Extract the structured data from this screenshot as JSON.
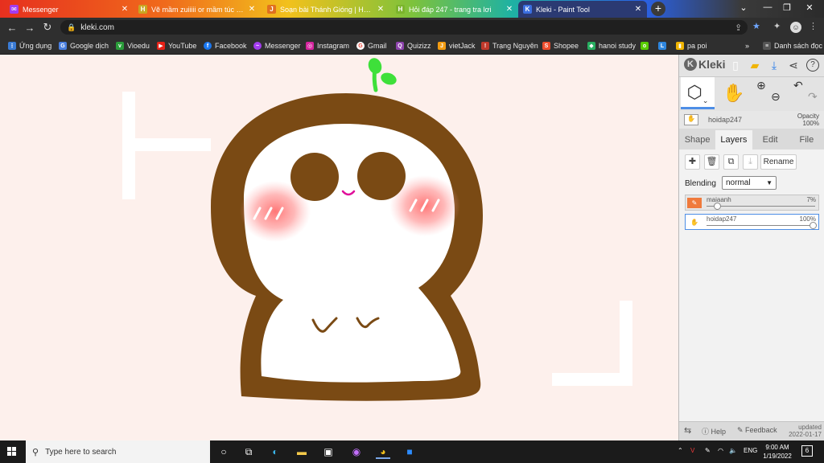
{
  "browser": {
    "tabs": [
      {
        "title": "Messenger",
        "icon": "messenger-icon",
        "color": "#a33cf0"
      },
      {
        "title": "Vẽ mầm zuiiiii or mầm túc mừng",
        "icon": "hoidap-icon",
        "color": "#c9a622"
      },
      {
        "title": "Soạn bài Thánh Gióng | Hay nhất",
        "icon": "vietjack-icon",
        "color": "#e0701f"
      },
      {
        "title": "Hỏi đáp 247 - trang tra lơi",
        "icon": "hoidap-icon",
        "color": "#7bb42c"
      },
      {
        "title": "Kleki - Paint Tool",
        "icon": "kleki-icon",
        "color": "#3b6fe0"
      }
    ],
    "new_tab": "+",
    "window_controls": {
      "minimize": "—",
      "restore": "❐",
      "close": "✕"
    },
    "url": "kleki.com",
    "bookmarks": [
      {
        "label": "Ứng dụng",
        "color": "#3a7bd5"
      },
      {
        "label": "Google dịch",
        "color": "#4a7fe0"
      },
      {
        "label": "Vioedu",
        "color": "#2a9d3a"
      },
      {
        "label": "YouTube",
        "color": "#e62117"
      },
      {
        "label": "Facebook",
        "color": "#1877f2"
      },
      {
        "label": "Messenger",
        "color": "#a33cf0"
      },
      {
        "label": "Instagram",
        "color": "#d6249f"
      },
      {
        "label": "Gmail",
        "color": "#ea4335"
      },
      {
        "label": "Quizizz",
        "color": "#8e44ad"
      },
      {
        "label": "vietJack",
        "color": "#f39c12"
      },
      {
        "label": "Trạng Nguyên",
        "color": "#c0392b"
      },
      {
        "label": "Shopee",
        "color": "#ee4d2d"
      },
      {
        "label": "hanoi study",
        "color": "#27ae60"
      },
      {
        "label": "",
        "color": "#58cc02"
      },
      {
        "label": "",
        "color": "#2e86de"
      },
      {
        "label": "pa poi",
        "color": "#f0b400"
      }
    ],
    "bookmarks_more": "»",
    "reading_list": "Danh sách đọc"
  },
  "kleki": {
    "logo": "Kleki",
    "current_layer_label": "hoidap247",
    "opacity_label": "Opacity",
    "opacity_value": "100%",
    "tabs": [
      "Shape",
      "Layers",
      "Edit",
      "File"
    ],
    "active_tab": "Layers",
    "rename_label": "Rename",
    "blending_label": "Blending",
    "blending_value": "normal",
    "layers": [
      {
        "name": "maiaanh",
        "opacity": "7%",
        "opacity_fraction": 0.07,
        "selected": false
      },
      {
        "name": "hoidap247",
        "opacity": "100%",
        "opacity_fraction": 1.0,
        "selected": true
      }
    ],
    "footer": {
      "help": "Help",
      "feedback": "Feedback",
      "updated_label": "updated",
      "updated_date": "2022-01-17"
    }
  },
  "taskbar": {
    "search_placeholder": "Type here to search",
    "language": "ENG",
    "time": "9:00 AM",
    "date": "1/19/2022",
    "notification_count": "6"
  },
  "colors": {
    "canvas_bg": "#fdf0ec",
    "hair_brown": "#7a4a14",
    "blush": "#ff7b7b",
    "sprout_green": "#3ee03a",
    "accent_blue": "#4d8ee6"
  }
}
